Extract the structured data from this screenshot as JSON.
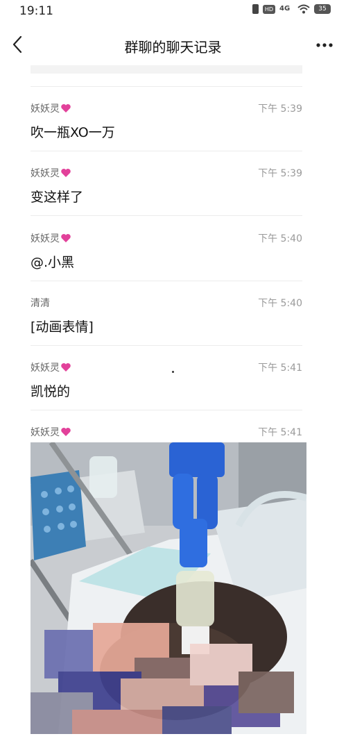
{
  "status_bar": {
    "time": "19:11",
    "icons": [
      "vibrate-icon",
      "hd-icon",
      "4g-signal-icon",
      "wifi-icon",
      "battery-icon"
    ],
    "hd_label": "HD",
    "network": "4G",
    "battery_level": "35"
  },
  "nav": {
    "title": "群聊的聊天记录",
    "back_icon": "chevron-left-icon",
    "more_icon": "more-dots-icon"
  },
  "messages": [
    {
      "sender": "妖妖灵",
      "time": "下午 5:39",
      "text": "吹一瓶XO一万",
      "heart": true
    },
    {
      "sender": "妖妖灵",
      "time": "下午 5:39",
      "text": "变这样了",
      "heart": true
    },
    {
      "sender": "妖妖灵",
      "time": "下午 5:40",
      "text": "@.小黑",
      "heart": true
    },
    {
      "sender": "清清",
      "time": "下午 5:40",
      "text": "[动画表情]",
      "heart": false
    },
    {
      "sender": "妖妖灵",
      "time": "下午 5:41",
      "text": "凯悦的",
      "heart": true
    },
    {
      "sender": "妖妖灵",
      "time": "下午 5:41",
      "text": "",
      "heart": true,
      "image": "hospital-photo"
    }
  ],
  "colors": {
    "heart": "#e2419a",
    "divider": "#ececec",
    "time_text": "#9a9a9a",
    "sender_text": "#666666"
  }
}
